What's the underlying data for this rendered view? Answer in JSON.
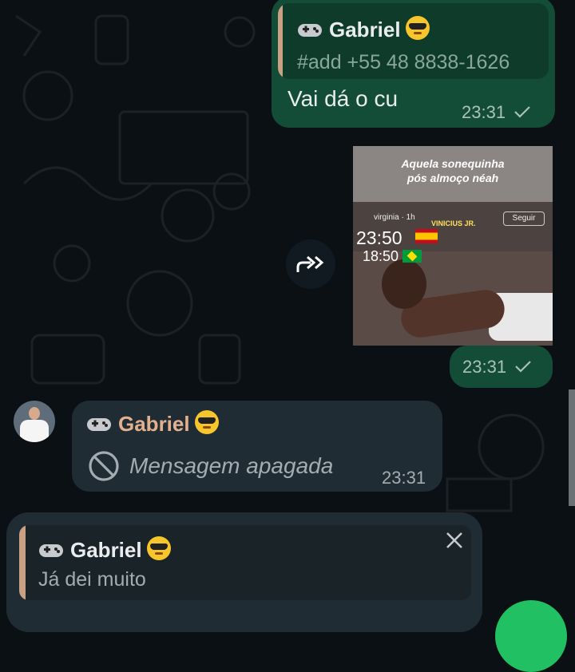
{
  "messages": {
    "quoted_reply": {
      "quote_author": "Gabriel",
      "quote_text": "#add +55 48 8838-1626",
      "text": "Vai dá o cu",
      "time": "23:31",
      "status_icon": "check-icon"
    },
    "image_message": {
      "image_caption_line1": "Aquela sonequinha",
      "image_caption_line2": "pós almoço néah",
      "image_username": "virginia",
      "image_username_time": "1h",
      "image_overlay_name": "VINICIUS JR.",
      "image_follow_label": "Seguir",
      "image_time_1": "23:50",
      "image_time_2": "18:50",
      "time": "23:31",
      "status_icon": "check-icon",
      "forward_icon": "forward-icon"
    },
    "deleted_message": {
      "author": "Gabriel",
      "text": "Mensagem apagada",
      "time": "23:31",
      "icon": "blocked-icon"
    }
  },
  "reply_preview": {
    "author": "Gabriel",
    "text": "Já dei muito",
    "close_icon": "close-icon"
  },
  "colors": {
    "background": "#0b1014",
    "outgoing_bubble": "#144d37",
    "incoming_bubble": "#202c33",
    "author_accent": "#e3b08f",
    "fab": "#21c063"
  }
}
